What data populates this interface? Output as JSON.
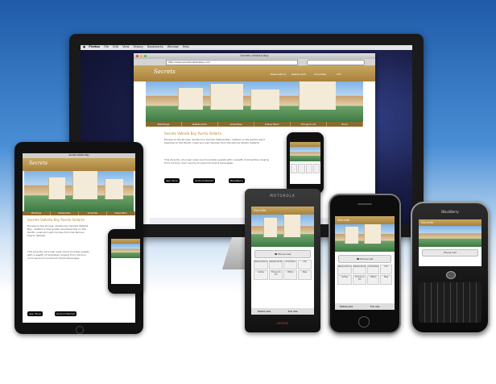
{
  "mac": {
    "menu": [
      "Firefox",
      "File",
      "Edit",
      "View",
      "History",
      "Bookmarks",
      "Window",
      "Help"
    ],
    "window_title": "Secrets Vallarta Bay",
    "url": "http://www.secretsvallartabay.com"
  },
  "site": {
    "brand": "Secrets",
    "nav": [
      "Weddings",
      "Restaurants",
      "Amenities",
      "Suites Menu",
      "Things to Do",
      "Book"
    ],
    "top_icons": [
      "Reservations",
      "Restaurants",
      "Amenities",
      "Info"
    ],
    "title": "Secrets Vallarta Bay Puerto Vallarta",
    "body": "Escape to the all-new, adults-only Secrets Vallarta Bay, nestled on the golden sand beaches on the Pacific coast and just minutes from the famous Puerto Vallarta.",
    "body2": "This all-suite, all ocean view resort provides guests with a wealth of amenities ranging from 24-hour room service to premium brand beverages.",
    "app_store": "App Store",
    "android": "Android Market",
    "blackberry": "BlackBerry"
  },
  "mobile": {
    "phone_call": "Phone Call",
    "icons": [
      "Reservations",
      "Restaurants",
      "Amenities",
      "Info",
      "Suites",
      "Things to Do",
      "Offers",
      "Map"
    ],
    "footer": [
      "Mobile site",
      "Full site"
    ]
  },
  "devices": {
    "droid_brand": "MOTOROLA",
    "droid_carrier": "verizon",
    "bb_brand": "BlackBerry"
  }
}
